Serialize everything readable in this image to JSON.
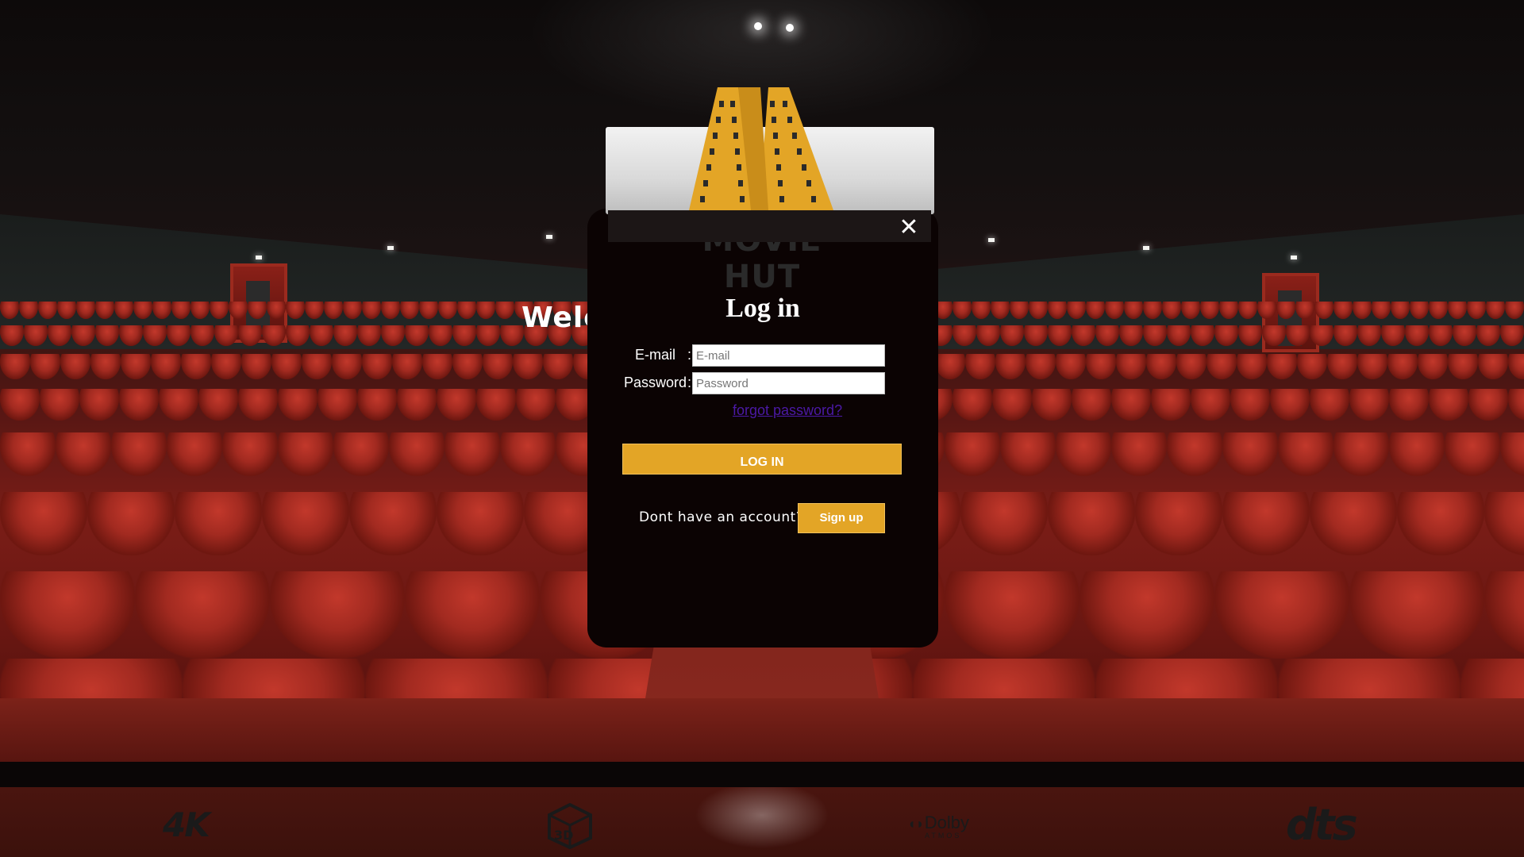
{
  "background": {
    "welcome_text": "Welcome to MovieHut...",
    "logo_text": "MOVIE HUT"
  },
  "modal": {
    "title": "Log in",
    "close_icon": "close-icon",
    "email": {
      "label": "E-mail",
      "colon": ":",
      "placeholder": "E-mail",
      "value": ""
    },
    "password": {
      "label": "Password",
      "colon": ":",
      "placeholder": "Password",
      "value": ""
    },
    "forgot_label": "forgot password?",
    "login_button_label": "LOG IN",
    "no_account_text": "Dont have an account?",
    "signup_button_label": "Sign up"
  },
  "footer": {
    "badges": [
      {
        "icon": "4k-icon",
        "label": "4K"
      },
      {
        "icon": "3d-icon",
        "label": "3D"
      },
      {
        "icon": "dolby-atmos-icon",
        "label": "Dolby",
        "sub": "ATMOS"
      },
      {
        "icon": "dts-icon",
        "label": "dts"
      }
    ]
  },
  "colors": {
    "accent": "#e3a526",
    "modal_bg": "#0b0303",
    "link": "#4b19a6",
    "footer_bg": "#4a150f"
  }
}
